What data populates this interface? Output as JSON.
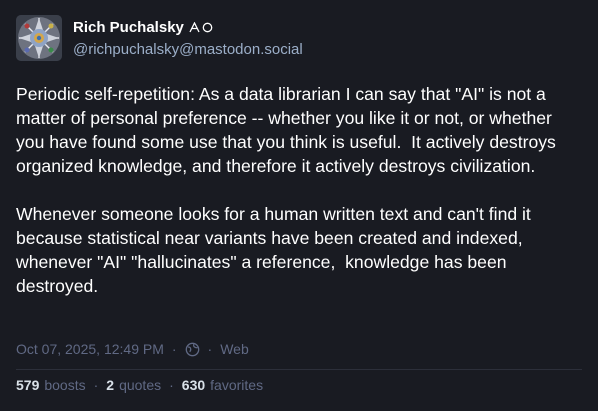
{
  "author": {
    "display_name": "Rich Puchalsky",
    "handle": "@richpuchalsky@mastodon.social"
  },
  "post": {
    "paragraphs": [
      "Periodic self-repetition: As a data librarian I can say that \"AI\" is not a matter of personal preference -- whether you like it or not, or whether you have found some use that you think is useful.  It actively destroys organized knowledge, and therefore it actively destroys civilization.",
      "Whenever someone looks for a human written text and can't find it because statistical near variants have been created and indexed, whenever \"AI\" \"hallucinates\" a reference,  knowledge has been destroyed."
    ],
    "timestamp": "Oct 07, 2025, 12:49 PM",
    "separator": "·",
    "visibility_icon": "globe-icon",
    "application": "Web"
  },
  "stats": {
    "boosts_count": "579",
    "boosts_label": "boosts",
    "quotes_count": "2",
    "quotes_label": "quotes",
    "favorites_count": "630",
    "favorites_label": "favorites"
  },
  "colors": {
    "background": "#191b22",
    "text": "#ffffff",
    "handle": "#9baec8",
    "meta": "#606984"
  }
}
